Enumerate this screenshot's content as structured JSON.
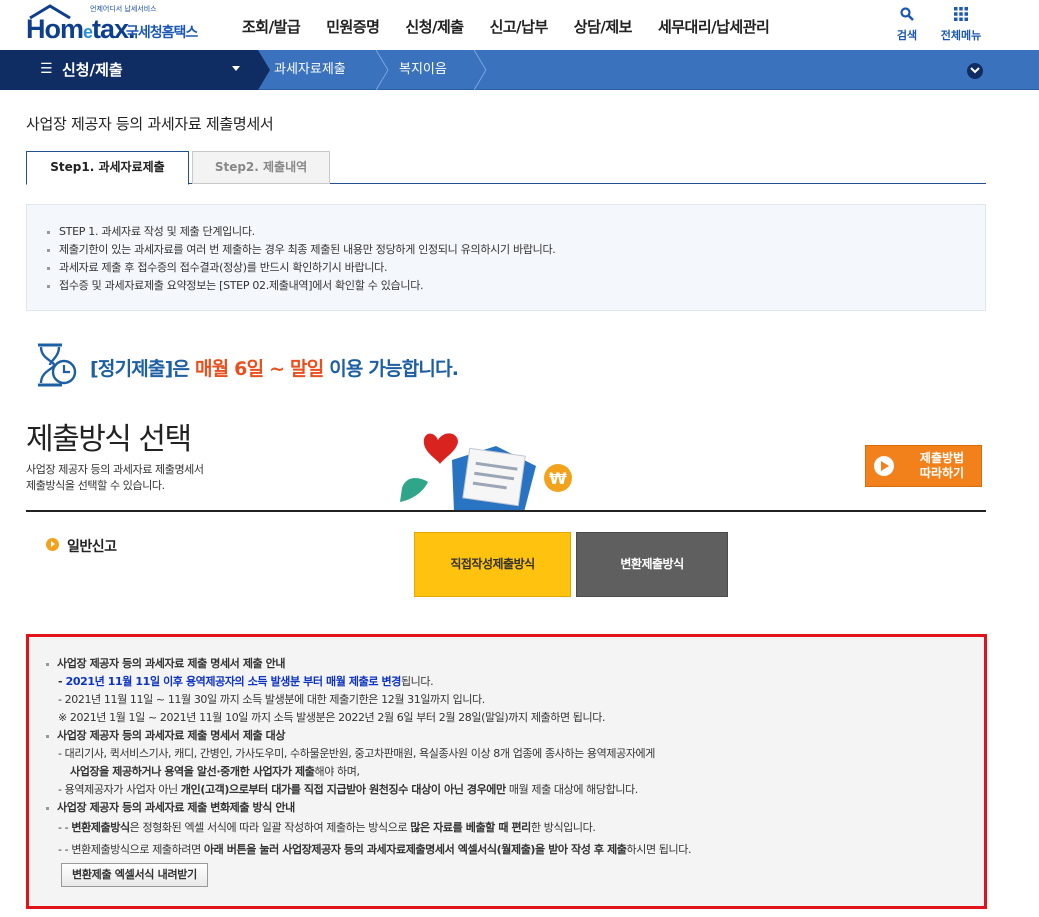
{
  "header": {
    "logo_sub": "언제어디서 납세서비스",
    "logo_brand_1": "Hom",
    "logo_brand_e": "e",
    "logo_brand_2": "tax.",
    "logo_kr": "국세청홈택스",
    "gnb": [
      "조회/발급",
      "민원증명",
      "신청/제출",
      "신고/납부",
      "상담/제보",
      "세무대리/납세관리"
    ],
    "search_label": "검색",
    "menu_label": "전체메뉴"
  },
  "nav": {
    "main": "신청/제출",
    "crumb1": "과세자료제출",
    "crumb2": "복지이음"
  },
  "page": {
    "title": "사업장 제공자 등의 과세자료 제출명세서",
    "tab1": "Step1. 과세자료제출",
    "tab2": "Step2. 제출내역"
  },
  "info": [
    "STEP 1. 과세자료 작성 및 제출 단계입니다.",
    "제출기한이 있는 과세자료를 여러 번 제출하는 경우 최종 제출된 내용만 정당하게 인정되니 유의하시기 바랍니다.",
    "과세자료 제출 후 접수증의 접수결과(정상)를 반드시 확인하기시 바랍니다.",
    "접수증 및 과세자료제출 요약정보는 [STEP 02.제출내역]에서 확인할 수 있습니다."
  ],
  "period": {
    "p1": "[정기제출]은 ",
    "p2": "매월 6일 ~ 말일",
    "p3": " 이용 가능합니다."
  },
  "method": {
    "title": "제출방식 선택",
    "desc1": "사업장 제공자 등의 과세자료 제출명세서",
    "desc2": "제출방식을 선택할 수 있습니다.",
    "guide_line1": "제출방법",
    "guide_line2": "따라하기",
    "general": "일반신고",
    "direct": "직접작성제출방식",
    "convert": "변환제출방식"
  },
  "notice": {
    "h1": "사업장 제공자 등의 과세자료 제출 명세서 제출 안내",
    "l1_a": "- ",
    "l1_blue": "2021년 11월 11일 이후 용역제공자의 소득 발생분 부터 매월 제출로 변경",
    "l1_b": "됩니다.",
    "l2": "- 2021년 11월 11일 ~ 11월 30일 까지 소득 발생분에 대한 제출기한은 12월 31일까지 입니다.",
    "l3": "※ 2021년 1월 1일 ~ 2021년 11월 10일 까지 소득 발생분은 2022년 2월 6일 부터 2월 28일(말일)까지 제출하면 됩니다.",
    "h2": "사업장 제공자 등의 과세자료 제출 명세서 제출 대상",
    "l4": "- 대리기사, 퀵서비스기사, 캐디, 간병인, 가사도우미, 수하물운반원, 중고차판매원, 욕실종사원 이상 8개 업종에 종사하는 용역제공자에게",
    "l5_b": "사업장을 제공하거나 용역을 알선·중개한 사업자가 제출",
    "l5_a": "해야 하며,",
    "l6_a": "- 용역제공자가 사업자 아닌 ",
    "l6_b": "개인(고객)으로부터 대가를 직접 지급받아 원천징수 대상이 아닌 경우에만",
    "l6_c": " 매월 제출 대상에 해당합니다.",
    "h3": "사업장 제공자 등의 과세자료 제출 변화제출 방식 안내",
    "l7_a": "- - ",
    "l7_b": "변환제출방식",
    "l7_c": "은 정형화된 엑셀 서식에 따라 일괄 작성하여 제출하는 방식으로 ",
    "l7_d": "많은 자료를 베출할 때 편리",
    "l7_e": "한 방식입니다.",
    "l8_a": "- - 변환제출방식으로 제출하려면 ",
    "l8_b": "아래 버튼을 눌러 사업장제공자 등의 과세자료제출명세서 엑셀서식(월제출)을 받아 작성 후 제출",
    "l8_c": "하시면 됩니다.",
    "download": "변환제출 엑셀서식 내려받기"
  },
  "colors": {
    "navy": "#0f2d63",
    "nav_blue": "#3a72bd",
    "accent_orange": "#e8501e",
    "period_blue": "#1d5fa3",
    "yellow_button": "#ffc20e",
    "gray_button": "#5f5f5f",
    "notice_border": "#e2141b"
  },
  "icons": {
    "search": "search-icon",
    "menu": "grid-icon",
    "hamburger": "hamburger-icon",
    "toggle": "chevron-down-icon",
    "hourglass": "hourglass-clock-icon",
    "play": "play-icon",
    "bullet": "arrow-bullet-icon"
  }
}
